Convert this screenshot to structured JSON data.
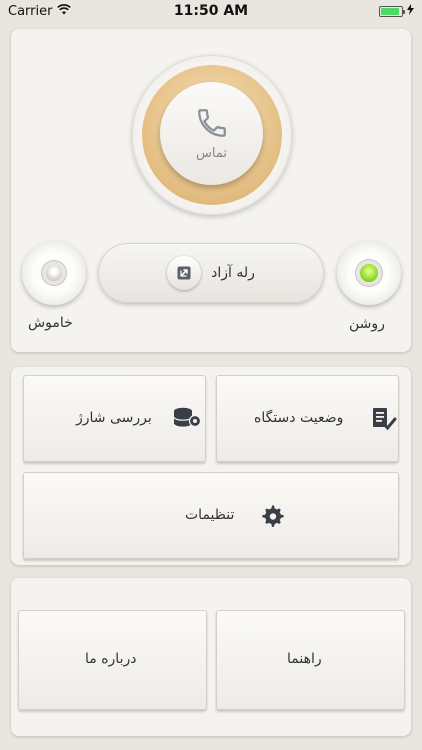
{
  "status_bar": {
    "carrier": "Carrier",
    "time": "11:50 AM",
    "battery_level": 0.9
  },
  "call": {
    "label": "تماس",
    "icon": "phone-icon"
  },
  "relay": {
    "label": "رله آزاد",
    "icon": "external-link-icon"
  },
  "toggles": {
    "off_label": "خاموش",
    "on_label": "روشن"
  },
  "menu": {
    "device_status": "وضعیت دستگاه",
    "check_charge": "بررسی شارژ",
    "settings": "تنظیمات",
    "help": "راهنما",
    "about": "درباره ما"
  },
  "colors": {
    "accent_gold": "#e6c188",
    "on_indicator": "#7ed321",
    "icon_dark": "#3a3f47",
    "battery_green": "#4cd964"
  }
}
